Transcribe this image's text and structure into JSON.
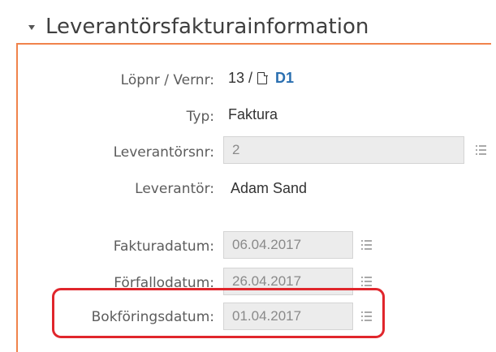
{
  "section": {
    "title": "Leverantörsfakturainformation"
  },
  "fields": {
    "lopnr": {
      "label": "Löpnr / Vernr:",
      "number": "13 /",
      "link": "D1"
    },
    "typ": {
      "label": "Typ:",
      "value": "Faktura"
    },
    "leverantorsnr": {
      "label": "Leverantörsnr:",
      "value": "2"
    },
    "leverantor": {
      "label": "Leverantör:",
      "value": "Adam Sand"
    },
    "fakturadatum": {
      "label": "Fakturadatum:",
      "value": "06.04.2017"
    },
    "forfallodatum": {
      "label": "Förfallodatum:",
      "value": "26.04.2017"
    },
    "bokforingsdatum": {
      "label": "Bokföringsdatum:",
      "value": "01.04.2017"
    }
  },
  "icons": {
    "section_toggle": "caret-down-icon",
    "voucher": "document-icon",
    "picker": "list-icon"
  },
  "colors": {
    "accent_orange": "#f0834b",
    "link_blue": "#2a6fb0",
    "highlight_red": "#e0262c",
    "field_background": "#ececec"
  }
}
